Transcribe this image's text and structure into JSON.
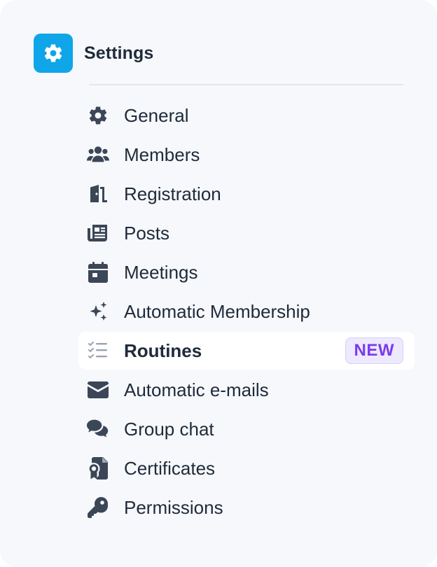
{
  "header": {
    "title": "Settings",
    "icon": "gear-icon",
    "accent_color": "#0ea5e9"
  },
  "menu": {
    "items": [
      {
        "label": "General",
        "icon": "gear-icon"
      },
      {
        "label": "Members",
        "icon": "users-icon"
      },
      {
        "label": "Registration",
        "icon": "door-open-icon"
      },
      {
        "label": "Posts",
        "icon": "newspaper-icon"
      },
      {
        "label": "Meetings",
        "icon": "calendar-icon"
      },
      {
        "label": "Automatic Membership",
        "icon": "sparkles-icon"
      },
      {
        "label": "Routines",
        "icon": "checklist-icon",
        "active": true,
        "badge": "NEW"
      },
      {
        "label": "Automatic e-mails",
        "icon": "envelope-icon"
      },
      {
        "label": "Group chat",
        "icon": "chat-bubbles-icon"
      },
      {
        "label": "Certificates",
        "icon": "certificate-icon"
      },
      {
        "label": "Permissions",
        "icon": "key-icon"
      }
    ]
  },
  "colors": {
    "icon": "#3b4657",
    "text": "#1f2a3a",
    "badge_text": "#7c3aed",
    "badge_bg": "#ede9fe",
    "panel_bg": "#f6f8fb"
  }
}
